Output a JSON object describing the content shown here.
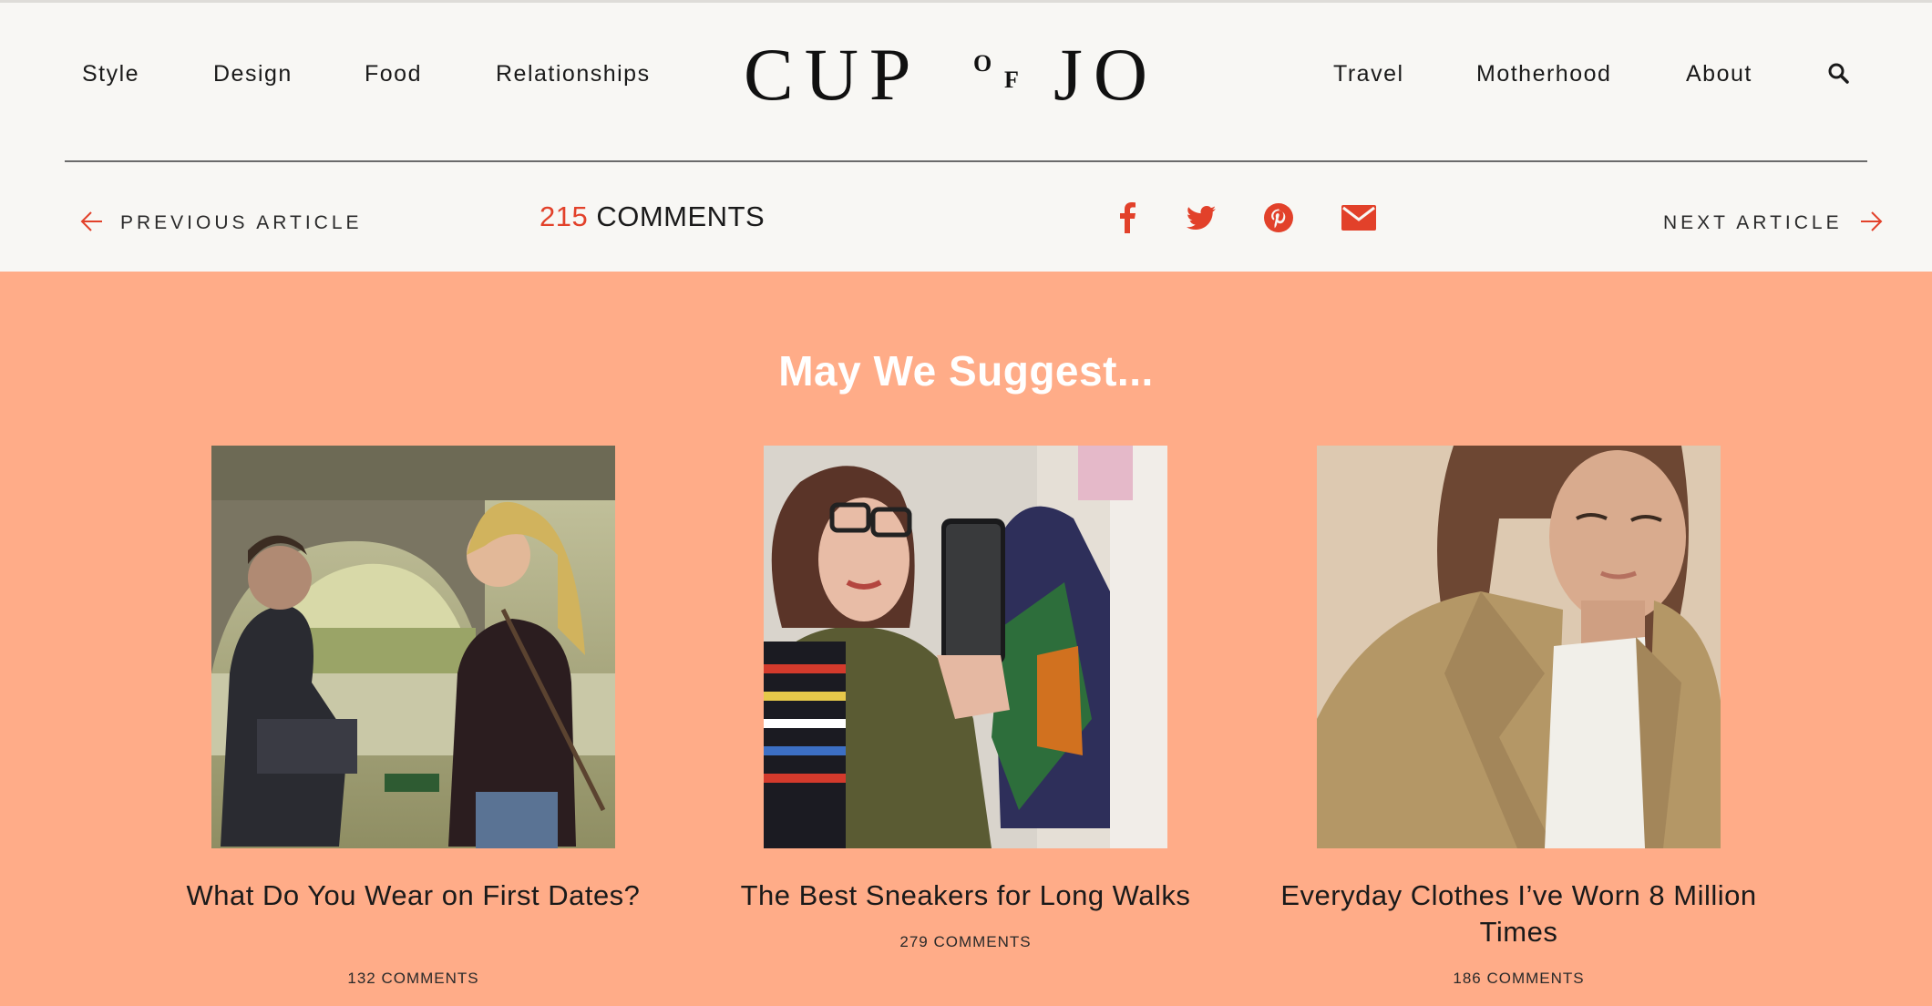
{
  "nav": {
    "left": [
      "Style",
      "Design",
      "Food",
      "Relationships"
    ],
    "right": [
      "Travel",
      "Motherhood",
      "About"
    ]
  },
  "logo": {
    "big1": "CUP",
    "of_o": "O",
    "of_f": "F",
    "big2": "JO"
  },
  "article_bar": {
    "previous": "PREVIOUS ARTICLE",
    "next": "NEXT ARTICLE",
    "comments_count": "215",
    "comments_label": "COMMENTS"
  },
  "share_icons": [
    "facebook-icon",
    "twitter-icon",
    "pinterest-icon",
    "email-icon"
  ],
  "suggest": {
    "title": "May We Suggest...",
    "cards": [
      {
        "title": "What Do You Wear on First Dates?",
        "comments": "132 COMMENTS"
      },
      {
        "title": "The Best Sneakers for Long Walks",
        "comments": "279 COMMENTS"
      },
      {
        "title": "Everyday Clothes I’ve Worn 8 Million Times",
        "comments": "186 COMMENTS"
      }
    ]
  },
  "colors": {
    "accent": "#e2412a",
    "suggest_bg": "#ffac88",
    "header_bg": "#f8f7f4"
  }
}
